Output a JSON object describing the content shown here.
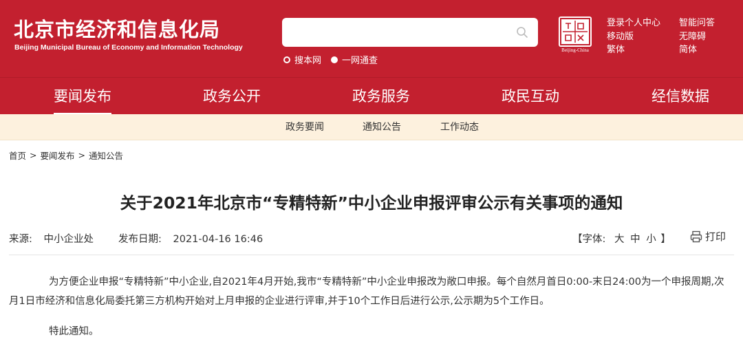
{
  "header": {
    "logo_cn": "北京市经济和信息化局",
    "logo_en": "Beijing Municipal Bureau of Economy and Information Technology",
    "search": {
      "placeholder": ""
    },
    "search_options": [
      "搜本网",
      "一网通查"
    ],
    "emblem": {
      "text": "Beijing-China"
    },
    "links_col1": [
      "登录个人中心",
      "移动版",
      "繁体"
    ],
    "links_col2": [
      "智能问答",
      "无障碍",
      "简体"
    ]
  },
  "nav": {
    "items": [
      "要闻发布",
      "政务公开",
      "政务服务",
      "政民互动",
      "经信数据"
    ],
    "active": 0
  },
  "subnav": {
    "items": [
      "政务要闻",
      "通知公告",
      "工作动态"
    ]
  },
  "breadcrumb": [
    "首页",
    "要闻发布",
    "通知公告"
  ],
  "article": {
    "title": "关于2021年北京市“专精特新”中小企业申报评审公示有关事项的通知",
    "source_label": "来源:",
    "source": "中小企业处",
    "date_label": "发布日期:",
    "date": "2021-04-16 16:46",
    "font_label": "【字体:",
    "font_sizes": [
      "大",
      "中",
      "小"
    ],
    "font_close": "】",
    "print_label": "打印",
    "paragraphs": [
      "为方便企业申报“专精特新”中小企业,自2021年4月开始,我市“专精特新”中小企业申报改为敞口申报。每个自然月首日0:00-末日24:00为一个申报周期,次月1日市经济和信息化局委托第三方机构开始对上月申报的企业进行评审,并于10个工作日后进行公示,公示期为5个工作日。",
      "特此通知。"
    ]
  },
  "colors": {
    "brand_red": "#c3202f",
    "subnav_bg": "#fdf1de"
  }
}
